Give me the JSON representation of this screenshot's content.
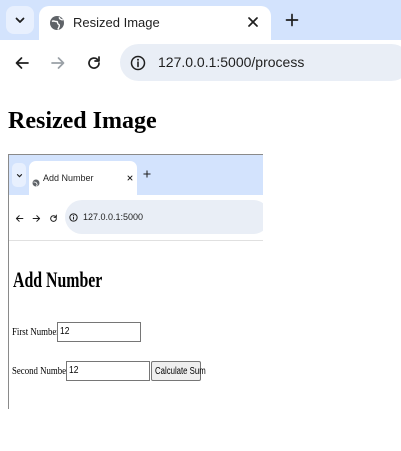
{
  "browser": {
    "tab_title": "Resized Image",
    "url": "127.0.0.1:5000/process",
    "icons": {
      "tab_search": "chevron-down-icon",
      "favicon": "globe-icon",
      "close": "close-icon",
      "new_tab": "plus-icon",
      "back": "back-arrow-icon",
      "forward": "forward-arrow-icon",
      "reload": "reload-icon",
      "site_info": "info-icon"
    },
    "colors": {
      "tabstrip": "#d3e3fd",
      "omnibox": "#e9eef6",
      "active_tab": "#ffffff"
    }
  },
  "page": {
    "heading": "Resized Image"
  },
  "resized_image": {
    "tab_title": "Add Number",
    "url": "127.0.0.1:5000",
    "heading": "Add Number",
    "form": {
      "first_label": "First Number:",
      "first_value": "12",
      "second_label": "Second Number:",
      "second_value": "12",
      "submit_label": "Calculate Sum"
    }
  }
}
